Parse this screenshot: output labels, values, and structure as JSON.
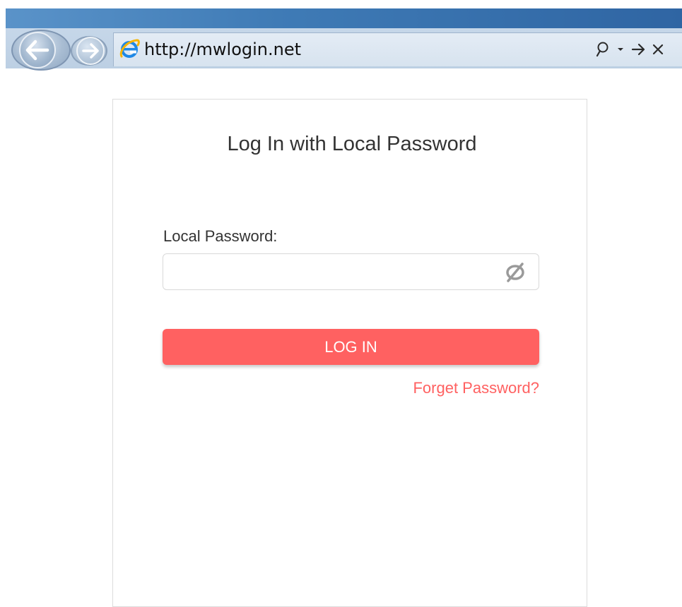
{
  "browser": {
    "url": "http://mwlogin.net",
    "icons": {
      "back": "back-arrow-icon",
      "forward": "forward-arrow-icon",
      "site": "ie-logo-icon",
      "search": "search-icon",
      "dropdown": "dropdown-caret-icon",
      "go": "go-arrow-icon",
      "stop": "close-icon"
    }
  },
  "login": {
    "title": "Log In with Local Password",
    "password_label": "Local Password:",
    "password_value": "",
    "login_button": "LOG IN",
    "forget_link": "Forget Password?",
    "toggle_icon": "hide-password-eye-icon"
  },
  "colors": {
    "accent": "#ff6161",
    "text": "#333333",
    "border": "#d9d9d9",
    "chrome_blue": "#3f7bb6"
  }
}
